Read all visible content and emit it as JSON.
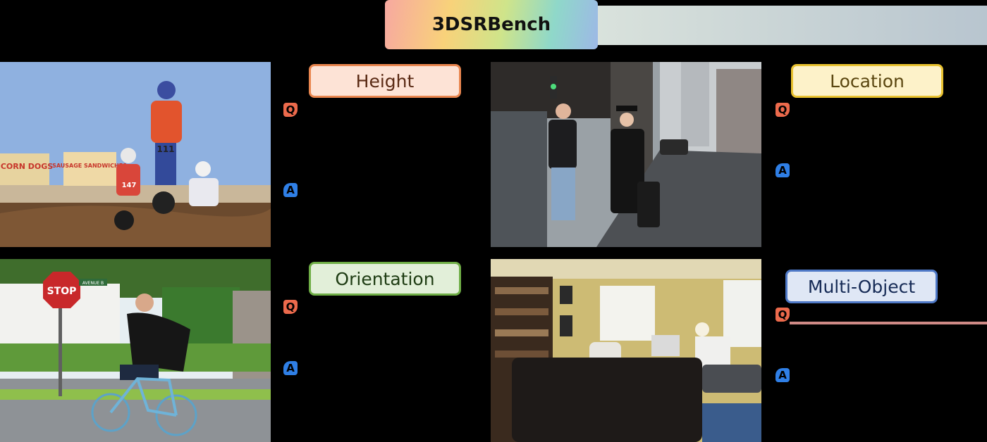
{
  "title": "3DSRBench",
  "categories": {
    "height": "Height",
    "location": "Location",
    "orientation": "Orientation",
    "multi_object": "Multi-Object"
  },
  "markers": {
    "question": "Q",
    "answer": "A"
  },
  "photo_text": {
    "stop_sign": "STOP",
    "street_sign": "AVENUE B",
    "banner_left": "CORN DOGS",
    "banner_right": "SAUSAGE SANDWICHES",
    "bike_number_front": "111",
    "bike_number_rear": "147"
  },
  "colors": {
    "height": "#e9864f",
    "location": "#e9c230",
    "orientation": "#6fae46",
    "multi_object": "#4e78c6",
    "question_marker": "#ec6a4c",
    "answer_marker": "#2f7fe6"
  }
}
